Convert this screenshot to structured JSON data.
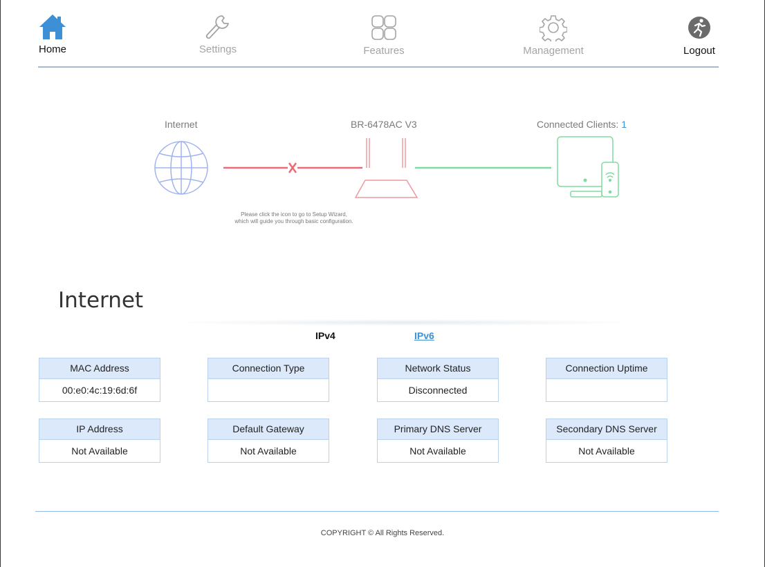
{
  "nav": {
    "home": {
      "label": "Home",
      "icon": "house-icon"
    },
    "settings": {
      "label": "Settings",
      "icon": "wrench-icon"
    },
    "features": {
      "label": "Features",
      "icon": "grid-icon"
    },
    "management": {
      "label": "Management",
      "icon": "gear-icon"
    },
    "logout": {
      "label": "Logout",
      "icon": "running-person-icon"
    }
  },
  "diagram": {
    "internet_label": "Internet",
    "device_label": "BR-6478AC V3",
    "clients_label": "Connected Clients: ",
    "clients_count": "1",
    "internet_status": "disconnected",
    "hint_line1": "Please click the icon to go to Setup Wizard,",
    "hint_line2": "which will guide you through basic configuration."
  },
  "internet": {
    "title": "Internet",
    "tabs": {
      "ipv4": "IPv4",
      "ipv6": "IPv6"
    },
    "fields": [
      {
        "label": "MAC Address",
        "value": "00:e0:4c:19:6d:6f"
      },
      {
        "label": "Connection Type",
        "value": ""
      },
      {
        "label": "Network Status",
        "value": "Disconnected"
      },
      {
        "label": "Connection Uptime",
        "value": ""
      },
      {
        "label": "IP Address",
        "value": "Not Available"
      },
      {
        "label": "Default Gateway",
        "value": "Not Available"
      },
      {
        "label": "Primary DNS Server",
        "value": "Not Available"
      },
      {
        "label": "Secondary DNS Server",
        "value": "Not Available"
      }
    ]
  },
  "footer": {
    "copyright": "COPYRIGHT © All Rights Reserved."
  },
  "colors": {
    "accent_blue": "#3d8fd6",
    "disconnected_red": "#ec6a72",
    "connected_green": "#7fdc9f",
    "globe_blue": "#9fb3ef",
    "box_header_bg": "#dbe9fa"
  }
}
